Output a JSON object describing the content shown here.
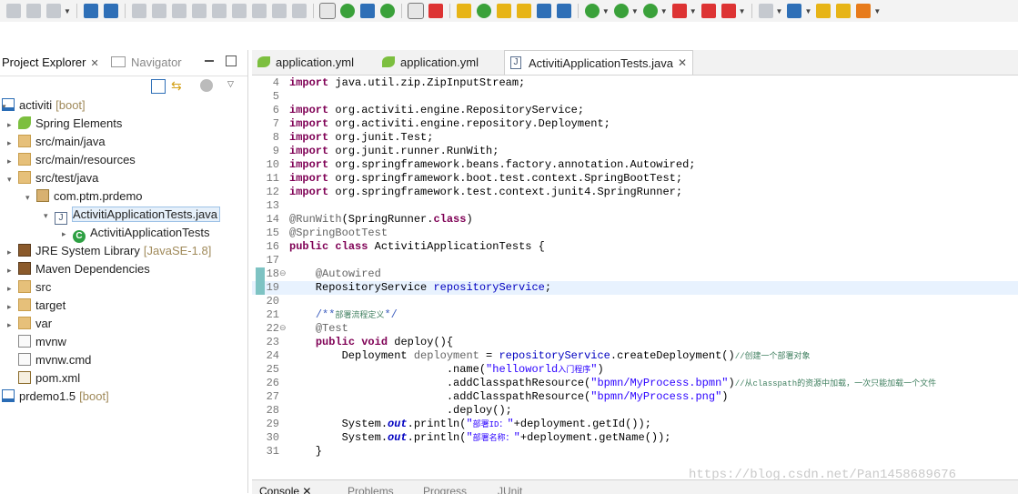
{
  "colors": {
    "accent": "#2e6fb7",
    "selection": "#e6f0fa",
    "current_line": "#e8f2fe",
    "keyword": "#7f0055",
    "string": "#2a00ff",
    "field": "#0000c0",
    "comment": "#3f7f5f",
    "annotation": "#646464"
  },
  "toolbar": {
    "icons": [
      "save-icon",
      "save-all-icon",
      "publish-icon",
      "monitor-icon",
      "skip-breakpoints-icon",
      "resume-icon",
      "suspend-icon",
      "terminate-icon",
      "disconnect-icon",
      "step-into-icon",
      "step-over-icon",
      "step-return-icon",
      "drop-to-frame-icon",
      "use-step-filters-icon",
      "toggle-mark-occurrences-icon",
      "wiki-icon",
      "a-icon",
      "spring-boot-dashboard-icon",
      "toggle-block-selection-icon",
      "eclipse-marketplace-icon",
      "open-task-icon",
      "next-annotation-icon",
      "highlight-icon",
      "open-resource-icon",
      "java-icon",
      "show-whitespace-icon",
      "debug-icon",
      "run-icon",
      "coverage-icon",
      "run-last-tool-icon",
      "stop-icon",
      "external-tools-icon",
      "new-server-icon",
      "spring-icon",
      "open-folder-icon",
      "open-type-icon",
      "spring-launch-icon"
    ]
  },
  "left_panel": {
    "tabs": {
      "project_explorer": "Project Explorer",
      "navigator": "Navigator",
      "close": "✕"
    },
    "tree": [
      {
        "label": "activiti",
        "decoration": "[boot]",
        "icon": "project-icon",
        "arrow": "▾",
        "indent": 0
      },
      {
        "label": "Spring Elements",
        "decoration": "",
        "icon": "spring-icon",
        "arrow": "▸",
        "indent": 1
      },
      {
        "label": "src/main/java",
        "decoration": "",
        "icon": "folder-icon",
        "arrow": "▸",
        "indent": 1
      },
      {
        "label": "src/main/resources",
        "decoration": "",
        "icon": "folder-icon",
        "arrow": "▸",
        "indent": 1
      },
      {
        "label": "src/test/java",
        "decoration": "",
        "icon": "folder-icon",
        "arrow": "▾",
        "indent": 1
      },
      {
        "label": "com.ptm.prdemo",
        "decoration": "",
        "icon": "package-icon",
        "arrow": "▾",
        "indent": 2
      },
      {
        "label": "ActivitiApplicationTests.java",
        "decoration": "",
        "icon": "java-file-icon",
        "arrow": "▾",
        "indent": 3
      },
      {
        "label": "ActivitiApplicationTests",
        "decoration": "",
        "icon": "class-icon",
        "arrow": "▸",
        "indent": 4
      },
      {
        "label": "JRE System Library",
        "decoration": "[JavaSE-1.8]",
        "icon": "library-icon",
        "arrow": "▸",
        "indent": 1
      },
      {
        "label": "Maven Dependencies",
        "decoration": "",
        "icon": "library-icon",
        "arrow": "▸",
        "indent": 1
      },
      {
        "label": "src",
        "decoration": "",
        "icon": "folder-icon",
        "arrow": "▸",
        "indent": 1
      },
      {
        "label": "target",
        "decoration": "",
        "icon": "folder-icon",
        "arrow": "▸",
        "indent": 1
      },
      {
        "label": "var",
        "decoration": "",
        "icon": "folder-icon",
        "arrow": "▸",
        "indent": 1
      },
      {
        "label": "mvnw",
        "decoration": "",
        "icon": "file-icon",
        "arrow": "",
        "indent": 1
      },
      {
        "label": "mvnw.cmd",
        "decoration": "",
        "icon": "file-icon",
        "arrow": "",
        "indent": 1
      },
      {
        "label": "pom.xml",
        "decoration": "",
        "icon": "xml-icon",
        "arrow": "",
        "indent": 1
      },
      {
        "label": "prdemo1.5",
        "decoration": "[boot]",
        "icon": "project-icon",
        "arrow": "",
        "indent": 0
      }
    ]
  },
  "editor": {
    "tabs": [
      {
        "label": "application.yml"
      },
      {
        "label": "application.yml"
      },
      {
        "label": "ActivitiApplicationTests.java",
        "close": "✕"
      }
    ],
    "lines": [
      {
        "n": "4",
        "parts": [
          [
            "kw",
            "import"
          ],
          [
            "cn",
            " java.util.zip.ZipInputStream;"
          ]
        ]
      },
      {
        "n": "5",
        "parts": []
      },
      {
        "n": "6",
        "parts": [
          [
            "kw",
            "import"
          ],
          [
            "cn",
            " org.activiti.engine.RepositoryService;"
          ]
        ]
      },
      {
        "n": "7",
        "parts": [
          [
            "kw",
            "import"
          ],
          [
            "cn",
            " org.activiti.engine.repository.Deployment;"
          ]
        ]
      },
      {
        "n": "8",
        "parts": [
          [
            "kw",
            "import"
          ],
          [
            "cn",
            " org.junit.Test;"
          ]
        ]
      },
      {
        "n": "9",
        "parts": [
          [
            "kw",
            "import"
          ],
          [
            "cn",
            " org.junit.runner.RunWith;"
          ]
        ]
      },
      {
        "n": "10",
        "parts": [
          [
            "kw",
            "import"
          ],
          [
            "cn",
            " org.springframework.beans.factory.annotation.Autowired;"
          ]
        ]
      },
      {
        "n": "11",
        "parts": [
          [
            "kw",
            "import"
          ],
          [
            "cn",
            " org.springframework.boot.test.context.SpringBootTest;"
          ]
        ]
      },
      {
        "n": "12",
        "parts": [
          [
            "kw",
            "import"
          ],
          [
            "cn",
            " org.springframework.test.context.junit4.SpringRunner;"
          ]
        ]
      },
      {
        "n": "13",
        "parts": []
      },
      {
        "n": "14",
        "parts": [
          [
            "an",
            "@RunWith"
          ],
          [
            "cn",
            "(SpringRunner."
          ],
          [
            "kw",
            "class"
          ],
          [
            "cn",
            ")"
          ]
        ]
      },
      {
        "n": "15",
        "parts": [
          [
            "an",
            "@SpringBootTest"
          ]
        ]
      },
      {
        "n": "16",
        "parts": [
          [
            "kw",
            "public"
          ],
          [
            "cn",
            " "
          ],
          [
            "kw",
            "class"
          ],
          [
            "cn",
            " ActivitiApplicationTests {"
          ]
        ]
      },
      {
        "n": "17",
        "parts": []
      },
      {
        "n": "18",
        "fold": "⊖",
        "mark": true,
        "parts": [
          [
            "cn",
            "    "
          ],
          [
            "an",
            "@Autowired"
          ]
        ]
      },
      {
        "n": "19",
        "mark": true,
        "current": true,
        "parts": [
          [
            "cn",
            "    RepositoryService "
          ],
          [
            "fld",
            "repositoryService"
          ],
          [
            "cn",
            ";"
          ]
        ]
      },
      {
        "n": "20",
        "parts": []
      },
      {
        "n": "21",
        "parts": [
          [
            "cn",
            "    "
          ],
          [
            "jd",
            "/**"
          ],
          [
            "cm",
            "部署流程定义"
          ],
          [
            "jd",
            "*/"
          ]
        ]
      },
      {
        "n": "22",
        "fold": "⊖",
        "parts": [
          [
            "cn",
            "    "
          ],
          [
            "an",
            "@Test"
          ]
        ]
      },
      {
        "n": "23",
        "parts": [
          [
            "cn",
            "    "
          ],
          [
            "kw",
            "public"
          ],
          [
            "cn",
            " "
          ],
          [
            "kw",
            "void"
          ],
          [
            "cn",
            " deploy(){"
          ]
        ]
      },
      {
        "n": "24",
        "parts": [
          [
            "cn",
            "        Deployment "
          ],
          [
            "an",
            "deployment"
          ],
          [
            "cn",
            " = "
          ],
          [
            "fld",
            "repositoryService"
          ],
          [
            "cn",
            ".createDeployment()"
          ],
          [
            "cm",
            "//创建一个部署对象"
          ]
        ]
      },
      {
        "n": "25",
        "parts": [
          [
            "cn",
            "                        .name("
          ],
          [
            "st",
            "\"helloworld"
          ],
          [
            "stsm",
            "入门程序"
          ],
          [
            "st",
            "\""
          ],
          [
            "cn",
            ")"
          ]
        ]
      },
      {
        "n": "26",
        "parts": [
          [
            "cn",
            "                        .addClasspathResource("
          ],
          [
            "st",
            "\"bpmn/MyProcess.bpmn\""
          ],
          [
            "cn",
            ")"
          ],
          [
            "cm",
            "//从classpath的资源中加载，一次只能加载一个文件"
          ]
        ]
      },
      {
        "n": "27",
        "parts": [
          [
            "cn",
            "                        .addClasspathResource("
          ],
          [
            "st",
            "\"bpmn/MyProcess.png\""
          ],
          [
            "cn",
            ")"
          ]
        ]
      },
      {
        "n": "28",
        "parts": [
          [
            "cn",
            "                        .deploy();"
          ]
        ]
      },
      {
        "n": "29",
        "parts": [
          [
            "cn",
            "        System."
          ],
          [
            "sti",
            "out"
          ],
          [
            "cn",
            ".println("
          ],
          [
            "st",
            "\""
          ],
          [
            "stsm",
            "部署ID："
          ],
          [
            "st",
            "\""
          ],
          [
            "cn",
            "+deployment.getId());"
          ]
        ]
      },
      {
        "n": "30",
        "parts": [
          [
            "cn",
            "        System."
          ],
          [
            "sti",
            "out"
          ],
          [
            "cn",
            ".println("
          ],
          [
            "st",
            "\""
          ],
          [
            "stsm",
            "部署名称："
          ],
          [
            "st",
            "\""
          ],
          [
            "cn",
            "+deployment.getName());"
          ]
        ]
      },
      {
        "n": "31",
        "parts": [
          [
            "cn",
            "    }"
          ]
        ]
      }
    ]
  },
  "watermark": "https://blog.csdn.net/Pan1458689676",
  "bottom_panel": {
    "tabs": [
      "Console",
      "Problems",
      "Progress",
      "JUnit"
    ],
    "console_close": "✕"
  }
}
